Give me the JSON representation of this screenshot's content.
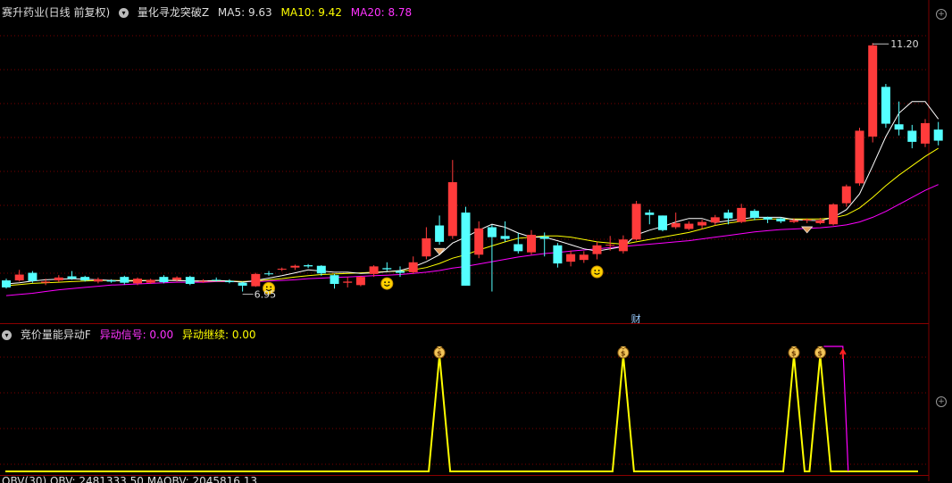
{
  "colors": {
    "up": "#ff3b3b",
    "down": "#54ffff",
    "ma5": "#ffffff",
    "ma10": "#ffff00",
    "ma20": "#ff00ff",
    "grid": "#7a0000",
    "signal": "#ffff00",
    "signal2": "#ff00ff"
  },
  "main_header": {
    "stock": "赛升药业(日线 前复权)",
    "indicator": "量化寻龙突破Z",
    "ma5_label": "MA5: 9.63",
    "ma10_label": "MA10: 9.42",
    "ma20_label": "MA20: 8.78"
  },
  "price_labels": {
    "high": "11.20",
    "low": "6.95",
    "fin_marker": "财"
  },
  "sub_header": {
    "indicator": "竞价量能异动F",
    "signal_label": "异动信号: 0.00",
    "continue_label": "异动继续: 0.00"
  },
  "bottom_header": {
    "text": "OBV(30)  OBV: 2481333.50  MAOBV: 2045816.13"
  },
  "icons": {
    "dropdown": "chevron-down-icon",
    "smiley": "smiley-icon",
    "money_bag": "money-bag-icon",
    "red_arrow": "up-arrow-icon",
    "maximize": "maximize-icon"
  },
  "chart_data": {
    "type": "candlestick",
    "ylim": [
      6.5,
      11.6
    ],
    "candles": [
      [
        7.14,
        7.02,
        7.17,
        7.0
      ],
      [
        7.14,
        7.24,
        7.32,
        7.12
      ],
      [
        7.27,
        7.13,
        7.3,
        7.1
      ],
      [
        7.1,
        7.12,
        7.17,
        7.06
      ],
      [
        7.14,
        7.19,
        7.23,
        7.11
      ],
      [
        7.21,
        7.17,
        7.3,
        7.15
      ],
      [
        7.2,
        7.14,
        7.22,
        7.12
      ],
      [
        7.12,
        7.16,
        7.19,
        7.09
      ],
      [
        7.14,
        7.12,
        7.16,
        7.1
      ],
      [
        7.2,
        7.1,
        7.22,
        7.07
      ],
      [
        7.09,
        7.17,
        7.19,
        7.06
      ],
      [
        7.1,
        7.15,
        7.17,
        7.08
      ],
      [
        7.2,
        7.11,
        7.23,
        7.09
      ],
      [
        7.15,
        7.19,
        7.21,
        7.12
      ],
      [
        7.2,
        7.08,
        7.22,
        7.06
      ],
      [
        7.12,
        7.13,
        7.16,
        7.1
      ],
      [
        7.15,
        7.14,
        7.19,
        7.12
      ],
      [
        7.13,
        7.11,
        7.16,
        7.09
      ],
      [
        7.1,
        7.05,
        7.12,
        6.95
      ],
      [
        7.04,
        7.25,
        7.27,
        7.03
      ],
      [
        7.26,
        7.25,
        7.3,
        7.22
      ],
      [
        7.33,
        7.34,
        7.36,
        7.3
      ],
      [
        7.36,
        7.39,
        7.41,
        7.32
      ],
      [
        7.4,
        7.38,
        7.42,
        7.35
      ],
      [
        7.39,
        7.26,
        7.4,
        7.22
      ],
      [
        7.23,
        7.08,
        7.25,
        7.0
      ],
      [
        7.1,
        7.12,
        7.2,
        7.02
      ],
      [
        7.06,
        7.2,
        7.22,
        7.04
      ],
      [
        7.25,
        7.38,
        7.4,
        7.2
      ],
      [
        7.35,
        7.33,
        7.45,
        7.3
      ],
      [
        7.3,
        7.27,
        7.38,
        7.2
      ],
      [
        7.28,
        7.45,
        7.55,
        7.25
      ],
      [
        7.55,
        7.86,
        8.05,
        7.5
      ],
      [
        8.08,
        7.8,
        8.25,
        7.75
      ],
      [
        7.9,
        8.82,
        9.2,
        7.85
      ],
      [
        8.3,
        7.05,
        8.4,
        7.05
      ],
      [
        7.58,
        8.03,
        8.15,
        7.52
      ],
      [
        8.05,
        7.88,
        8.09,
        6.95
      ],
      [
        7.9,
        7.85,
        8.15,
        7.8
      ],
      [
        7.76,
        7.64,
        7.95,
        7.6
      ],
      [
        7.62,
        7.92,
        8.0,
        7.58
      ],
      [
        7.89,
        7.85,
        7.96,
        7.55
      ],
      [
        7.74,
        7.43,
        7.78,
        7.36
      ],
      [
        7.46,
        7.59,
        7.65,
        7.38
      ],
      [
        7.49,
        7.58,
        7.64,
        7.44
      ],
      [
        7.59,
        7.74,
        7.8,
        7.5
      ],
      [
        7.74,
        7.75,
        7.9,
        7.65
      ],
      [
        7.64,
        7.84,
        7.91,
        7.6
      ],
      [
        7.84,
        8.45,
        8.5,
        7.82
      ],
      [
        8.3,
        8.26,
        8.35,
        8.1
      ],
      [
        8.25,
        8.0,
        8.25,
        7.98
      ],
      [
        8.05,
        8.12,
        8.3,
        8.02
      ],
      [
        8.02,
        8.11,
        8.15,
        8.0
      ],
      [
        8.08,
        8.14,
        8.18,
        8.02
      ],
      [
        8.13,
        8.22,
        8.26,
        8.08
      ],
      [
        8.3,
        8.2,
        8.35,
        8.1
      ],
      [
        8.14,
        8.38,
        8.45,
        8.12
      ],
      [
        8.33,
        8.21,
        8.36,
        8.17
      ],
      [
        8.22,
        8.18,
        8.23,
        8.12
      ],
      [
        8.2,
        8.15,
        8.22,
        8.12
      ],
      [
        8.14,
        8.17,
        8.2,
        8.12
      ],
      [
        8.17,
        8.18,
        8.2,
        8.12
      ],
      [
        8.12,
        8.17,
        8.21,
        8.1
      ],
      [
        8.1,
        8.44,
        8.46,
        8.08
      ],
      [
        8.46,
        8.75,
        8.78,
        8.4
      ],
      [
        8.8,
        9.7,
        9.75,
        8.76
      ],
      [
        9.6,
        11.16,
        11.2,
        9.5
      ],
      [
        10.45,
        9.82,
        10.5,
        9.75
      ],
      [
        9.81,
        9.72,
        10.2,
        9.62
      ],
      [
        9.7,
        9.51,
        9.8,
        9.4
      ],
      [
        9.48,
        9.83,
        9.9,
        9.42
      ],
      [
        9.72,
        9.53,
        9.85,
        9.45
      ]
    ],
    "ma5_series": [
      7.08,
      7.1,
      7.13,
      7.15,
      7.16,
      7.17,
      7.16,
      7.15,
      7.14,
      7.13,
      7.13,
      7.14,
      7.14,
      7.14,
      7.13,
      7.13,
      7.14,
      7.13,
      7.11,
      7.14,
      7.18,
      7.22,
      7.27,
      7.32,
      7.3,
      7.28,
      7.28,
      7.26,
      7.27,
      7.29,
      7.31,
      7.37,
      7.46,
      7.58,
      7.78,
      7.88,
      8.0,
      8.1,
      8.05,
      7.95,
      7.88,
      7.88,
      7.82,
      7.75,
      7.68,
      7.64,
      7.68,
      7.72,
      7.92,
      8.0,
      8.06,
      8.14,
      8.2,
      8.2,
      8.13,
      8.16,
      8.19,
      8.22,
      8.22,
      8.22,
      8.18,
      8.17,
      8.16,
      8.22,
      8.35,
      8.62,
      9.1,
      9.6,
      10.0,
      10.2,
      10.2,
      9.9
    ],
    "ma10_series": [
      7.05,
      7.07,
      7.09,
      7.1,
      7.11,
      7.12,
      7.13,
      7.14,
      7.14,
      7.14,
      7.14,
      7.14,
      7.14,
      7.14,
      7.13,
      7.13,
      7.13,
      7.13,
      7.12,
      7.13,
      7.15,
      7.17,
      7.2,
      7.22,
      7.24,
      7.25,
      7.26,
      7.27,
      7.28,
      7.29,
      7.3,
      7.32,
      7.36,
      7.43,
      7.52,
      7.58,
      7.66,
      7.73,
      7.8,
      7.86,
      7.88,
      7.9,
      7.9,
      7.88,
      7.84,
      7.8,
      7.78,
      7.76,
      7.8,
      7.84,
      7.88,
      7.92,
      7.96,
      8.02,
      8.08,
      8.12,
      8.15,
      8.18,
      8.19,
      8.19,
      8.19,
      8.19,
      8.19,
      8.21,
      8.26,
      8.38,
      8.56,
      8.76,
      8.94,
      9.1,
      9.26,
      9.4
    ],
    "ma20_series": [
      6.88,
      6.9,
      6.92,
      6.95,
      6.98,
      7.0,
      7.02,
      7.04,
      7.06,
      7.07,
      7.08,
      7.09,
      7.1,
      7.11,
      7.11,
      7.11,
      7.12,
      7.12,
      7.12,
      7.12,
      7.13,
      7.14,
      7.15,
      7.17,
      7.18,
      7.19,
      7.2,
      7.21,
      7.22,
      7.23,
      7.24,
      7.26,
      7.28,
      7.31,
      7.35,
      7.38,
      7.42,
      7.46,
      7.5,
      7.54,
      7.57,
      7.6,
      7.62,
      7.64,
      7.66,
      7.68,
      7.7,
      7.72,
      7.74,
      7.76,
      7.78,
      7.8,
      7.82,
      7.85,
      7.88,
      7.91,
      7.94,
      7.97,
      7.99,
      8.01,
      8.02,
      8.03,
      8.04,
      8.06,
      8.09,
      8.14,
      8.22,
      8.32,
      8.44,
      8.56,
      8.68,
      8.78
    ],
    "smiley_indices": [
      20,
      29,
      45
    ],
    "tip_indices": [
      33,
      61
    ],
    "signal_indices": [
      33,
      47,
      60,
      62
    ],
    "signal_end_index": 64
  }
}
